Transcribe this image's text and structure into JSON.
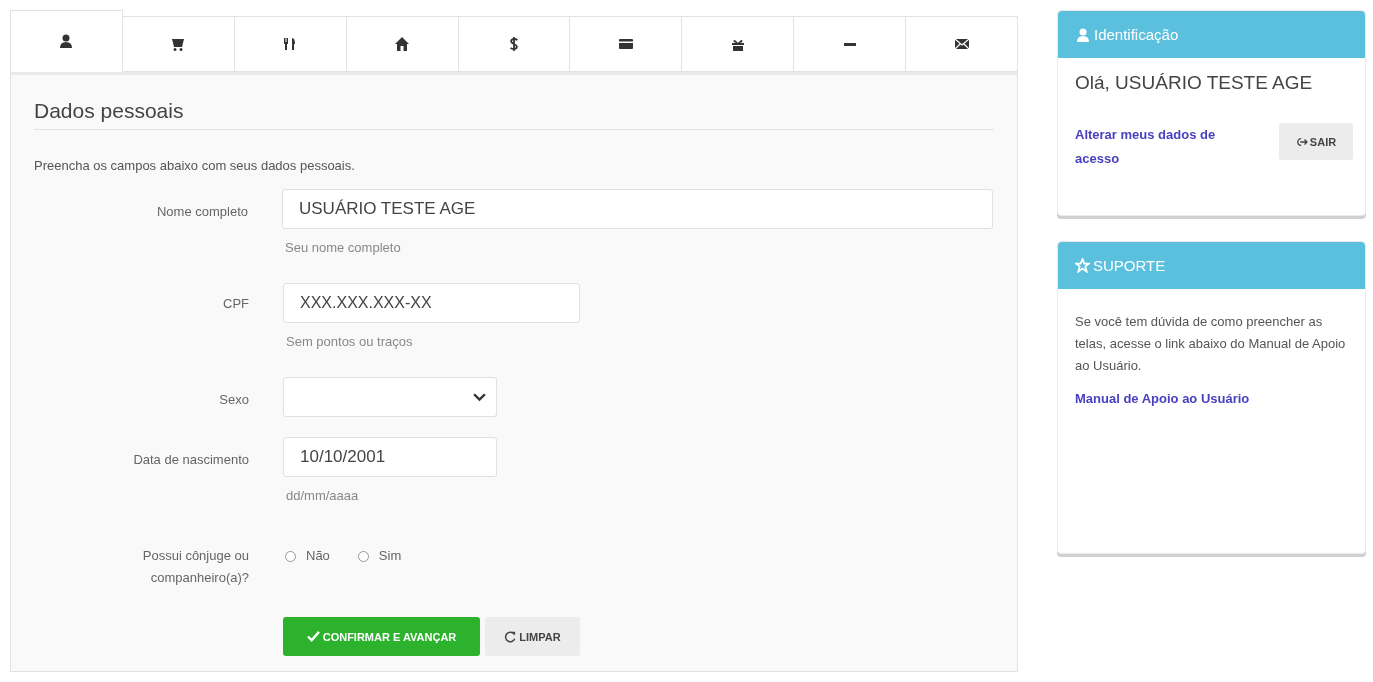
{
  "tabs": [
    {
      "kind": "user",
      "selected": true
    },
    {
      "kind": "cart",
      "selected": false
    },
    {
      "kind": "cutlery",
      "selected": false
    },
    {
      "kind": "home",
      "selected": false
    },
    {
      "kind": "dollar",
      "selected": false
    },
    {
      "kind": "card",
      "selected": false
    },
    {
      "kind": "gift",
      "selected": false
    },
    {
      "kind": "minus",
      "selected": false
    },
    {
      "kind": "envelope",
      "selected": false
    }
  ],
  "section": {
    "title": "Dados pessoais",
    "intro": "Preencha os campos abaixo com seus dados pessoais."
  },
  "fields": [
    {
      "kind": "name",
      "label": "Nome completo",
      "value": "USUÁRIO TESTE AGE",
      "help": "Seu nome completo"
    },
    {
      "kind": "cpf",
      "label": "CPF",
      "value": "XXX.XXX.XXX-XX",
      "help": "Sem pontos ou traços"
    },
    {
      "kind": "select",
      "label": "Sexo"
    },
    {
      "kind": "date",
      "label": "Data de nascimento",
      "value": "10/10/2001",
      "help": "dd/mm/aaaa"
    },
    {
      "kind": "radio",
      "label": "Possui cônjuge ou companheiro(a)?",
      "options": [
        {
          "label": "Não",
          "selected": false
        },
        {
          "label": "Sim",
          "selected": false
        }
      ]
    }
  ],
  "buttons": [
    {
      "kind": "primary",
      "label": "CONFIRMAR E AVANÇAR"
    },
    {
      "kind": "default",
      "label": "LIMPAR"
    }
  ],
  "identification": {
    "title": "Identificação",
    "greeting": "Olá, USUÁRIO TESTE AGE",
    "link": "Alterar meus dados de acesso",
    "logout": "SAIR"
  },
  "support": {
    "title": "SUPORTE",
    "text": "Se você tem dúvida de como preencher as telas, acesse o link abaixo do Manual de Apoio ao Usuário.",
    "link": "Manual de Apoio ao Usuário"
  }
}
